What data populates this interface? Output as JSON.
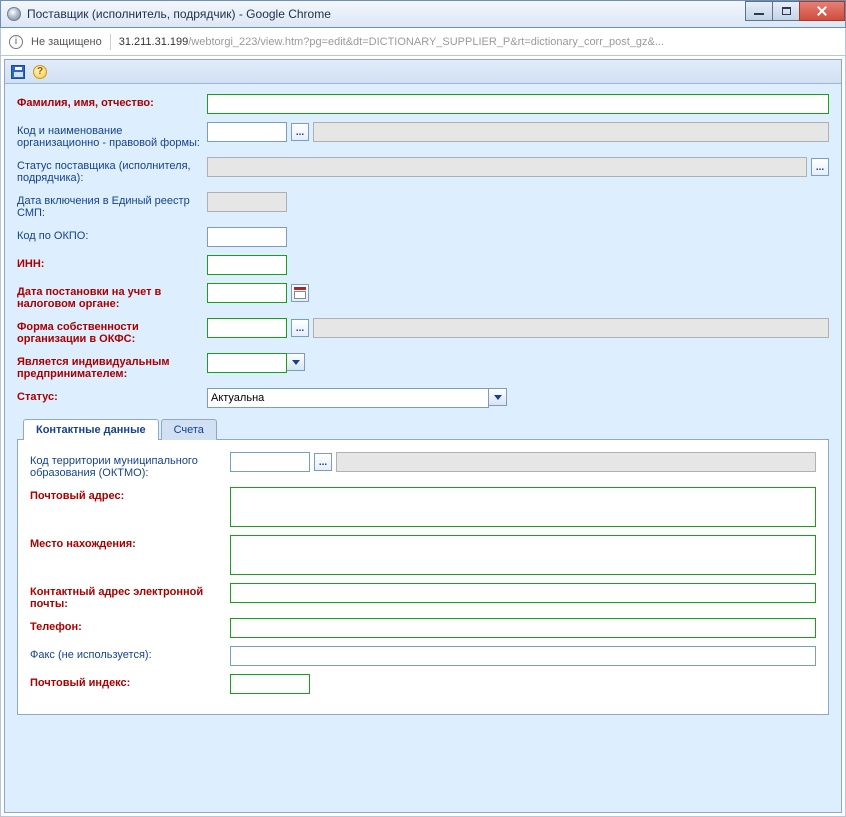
{
  "window": {
    "title": "Поставщик (исполнитель, подрядчик) - Google Chrome",
    "secure_label": "Не защищено",
    "host": "31.211.31.199",
    "path": "/webtorgi_223/view.htm?pg=edit&dt=DICTIONARY_SUPPLIER_P&rt=dictionary_corr_post_gz&..."
  },
  "toolbar": {
    "save": "Сохранить",
    "help": "Справка"
  },
  "labels": {
    "fio": "Фамилия, имя, отчество:",
    "org_form": "Код и наименование организационно - правовой формы:",
    "supplier_status": "Статус поставщика (исполнителя, подрядчика):",
    "smp_date": "Дата включения в Единый реестр СМП:",
    "okpo": "Код по ОКПО:",
    "inn": "ИНН:",
    "tax_date": "Дата постановки на учет в налоговом органе:",
    "okfs": "Форма собственности организации в ОКФС:",
    "is_ip": "Является индивидуальным предпринимателем:",
    "status": "Статус:"
  },
  "values": {
    "fio": "",
    "org_form_code": "",
    "org_form_name": "",
    "supplier_status": "",
    "smp_date": "",
    "okpo": "",
    "inn": "",
    "tax_date": "",
    "okfs_code": "",
    "okfs_name": "",
    "is_ip": "",
    "status": "Актуальна"
  },
  "tabs": {
    "contacts": "Контактные данные",
    "accounts": "Счета"
  },
  "contacts": {
    "labels": {
      "oktmo": "Код территории муниципального образования (ОКТМО):",
      "post_addr": "Почтовый адрес:",
      "location": "Место нахождения:",
      "email": "Контактный адрес электронной почты:",
      "phone": "Телефон:",
      "fax": "Факс (не используется):",
      "zip": "Почтовый индекс:"
    },
    "values": {
      "oktmo_code": "",
      "oktmo_name": "",
      "post_addr": "",
      "location": "",
      "email": "",
      "phone": "",
      "fax": "",
      "zip": ""
    }
  }
}
